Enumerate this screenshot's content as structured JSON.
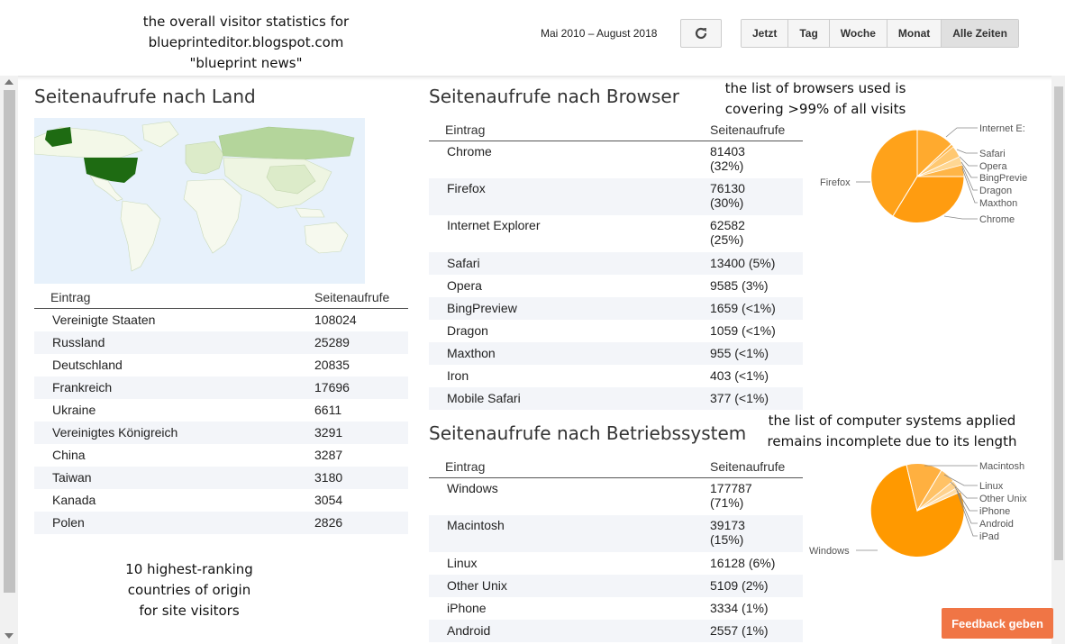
{
  "annotations": {
    "top": "the overall visitor statistics for\nblueprinteditor.blogspot.com\n\"blueprint news\"",
    "browsers": "the list of browsers used is\ncovering >99% of all visits",
    "os": "the list of computer systems applied\nremains incomplete due to its length",
    "countries": "10 highest-ranking\ncountries of origin\nfor site visitors"
  },
  "header": {
    "date_range": "Mai 2010 – August 2018",
    "range_buttons": [
      "Jetzt",
      "Tag",
      "Woche",
      "Monat",
      "Alle Zeiten"
    ],
    "active_range": "Alle Zeiten"
  },
  "country": {
    "title": "Seitenaufrufe nach Land",
    "col_entry": "Eintrag",
    "col_views": "Seitenaufrufe",
    "rows": [
      {
        "name": "Vereinigte Staaten",
        "value": "108024"
      },
      {
        "name": "Russland",
        "value": "25289"
      },
      {
        "name": "Deutschland",
        "value": "20835"
      },
      {
        "name": "Frankreich",
        "value": "17696"
      },
      {
        "name": "Ukraine",
        "value": "6611"
      },
      {
        "name": "Vereinigtes Königreich",
        "value": "3291"
      },
      {
        "name": "China",
        "value": "3287"
      },
      {
        "name": "Taiwan",
        "value": "3180"
      },
      {
        "name": "Kanada",
        "value": "3054"
      },
      {
        "name": "Polen",
        "value": "2826"
      }
    ]
  },
  "browser": {
    "title": "Seitenaufrufe nach Browser",
    "col_entry": "Eintrag",
    "col_views": "Seitenaufrufe",
    "rows": [
      {
        "name": "Chrome",
        "value": "81403",
        "pct": "(32%)"
      },
      {
        "name": "Firefox",
        "value": "76130",
        "pct": "(30%)"
      },
      {
        "name": "Internet Explorer",
        "value": "62582",
        "pct": "(25%)"
      },
      {
        "name": "Safari",
        "value": "13400 (5%)"
      },
      {
        "name": "Opera",
        "value": "9585 (3%)"
      },
      {
        "name": "BingPreview",
        "value": "1659 (<1%)"
      },
      {
        "name": "Dragon",
        "value": "1059 (<1%)"
      },
      {
        "name": "Maxthon",
        "value": "955 (<1%)"
      },
      {
        "name": "Iron",
        "value": "403 (<1%)"
      },
      {
        "name": "Mobile Safari",
        "value": "377 (<1%)"
      }
    ],
    "pie_labels": [
      "Internet E:",
      "Safari",
      "Opera",
      "BingPrevie",
      "Dragon",
      "Maxthon",
      "Chrome",
      "Firefox"
    ]
  },
  "os": {
    "title": "Seitenaufrufe nach Betriebssystem",
    "col_entry": "Eintrag",
    "col_views": "Seitenaufrufe",
    "rows": [
      {
        "name": "Windows",
        "value": "177787",
        "pct": "(71%)"
      },
      {
        "name": "Macintosh",
        "value": "39173",
        "pct": "(15%)"
      },
      {
        "name": "Linux",
        "value": "16128 (6%)"
      },
      {
        "name": "Other Unix",
        "value": "5109 (2%)"
      },
      {
        "name": "iPhone",
        "value": "3334 (1%)"
      },
      {
        "name": "Android",
        "value": "2557 (1%)"
      }
    ],
    "pie_labels": [
      "Macintosh",
      "Linux",
      "Other Unix",
      "iPhone",
      "Android",
      "iPad",
      "Windows"
    ]
  },
  "feedback": "Feedback geben",
  "colors": {
    "accent": "#f07545",
    "pie": "#ff9900",
    "map_dark": "#1e6b12"
  }
}
